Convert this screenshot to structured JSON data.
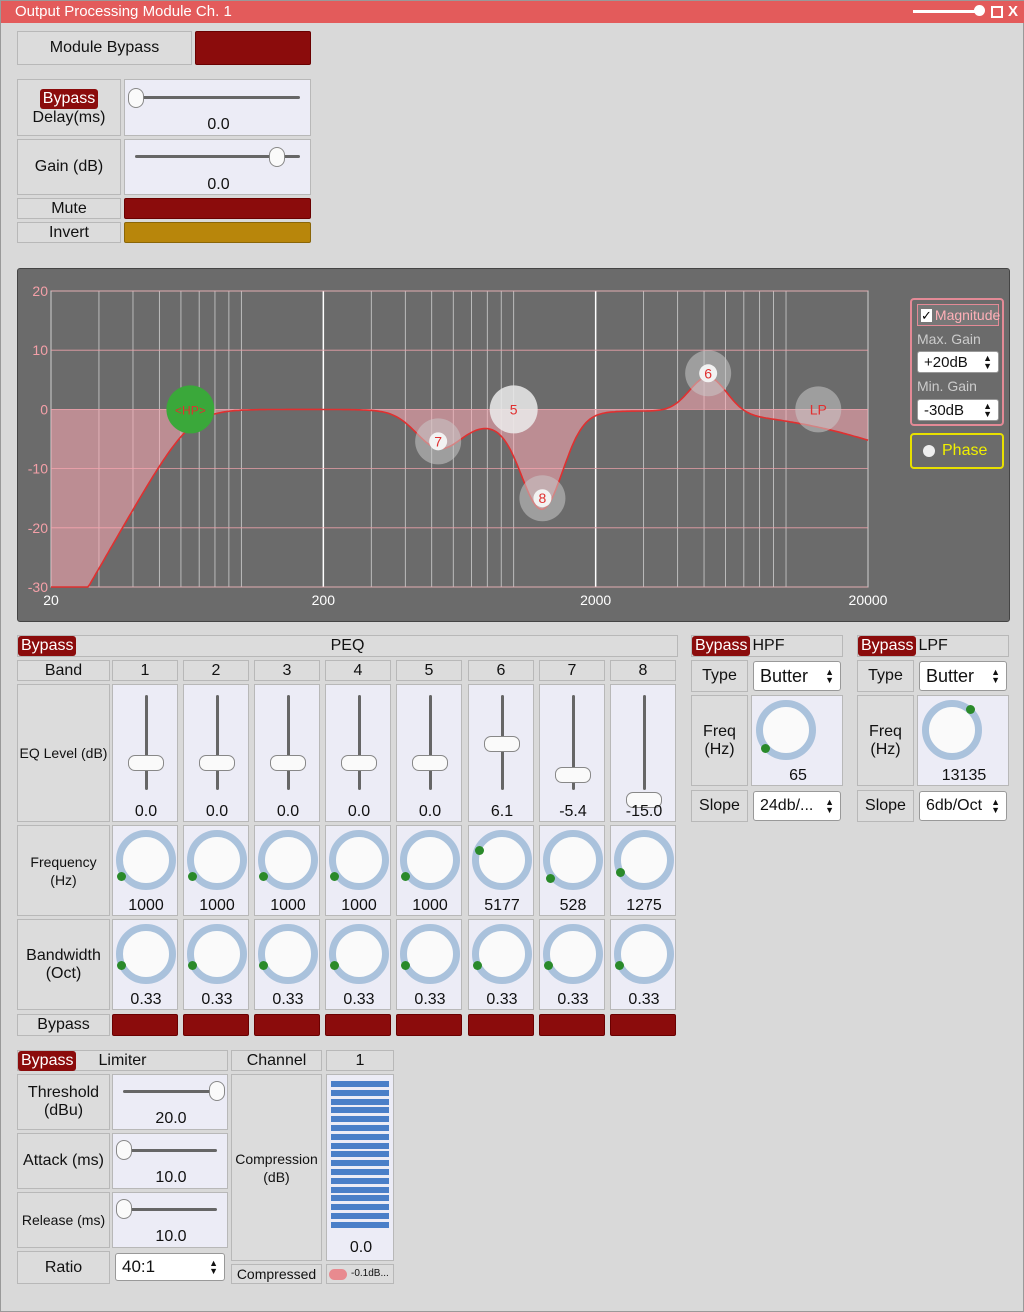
{
  "window": {
    "title": "Output Processing Module Ch. 1",
    "close_label": "X"
  },
  "top": {
    "module_bypass": "Module Bypass",
    "bypass_chip": "Bypass",
    "delay_label": "Delay(ms)",
    "delay_value": "0.0",
    "gain_label": "Gain (dB)",
    "gain_value": "0.0",
    "mute": "Mute",
    "invert": "Invert"
  },
  "graph": {
    "y_ticks": [
      "20",
      "10",
      "0",
      "-10",
      "-20",
      "-30"
    ],
    "x_ticks": [
      "20",
      "200",
      "2000",
      "20000"
    ],
    "nodes": [
      "<HP>",
      "7",
      "5",
      "8",
      "6",
      "LP"
    ],
    "magnitude_label": "Magnitude",
    "max_gain_label": "Max. Gain",
    "max_gain_value": "+20dB",
    "min_gain_label": "Min. Gain",
    "min_gain_value": "-30dB",
    "phase_label": "Phase"
  },
  "peq": {
    "bypass": "Bypass",
    "title": "PEQ",
    "band_label": "Band",
    "eq_level_label": "EQ Level (dB)",
    "frequency_label": "Frequency (Hz)",
    "bandwidth_label": "Bandwidth\n(Oct)",
    "bypass_row_label": "Bypass",
    "bands": [
      {
        "n": "1",
        "level": "0.0",
        "level_num": 0,
        "freq": "1000",
        "bw": "0.33"
      },
      {
        "n": "2",
        "level": "0.0",
        "level_num": 0,
        "freq": "1000",
        "bw": "0.33"
      },
      {
        "n": "3",
        "level": "0.0",
        "level_num": 0,
        "freq": "1000",
        "bw": "0.33"
      },
      {
        "n": "4",
        "level": "0.0",
        "level_num": 0,
        "freq": "1000",
        "bw": "0.33"
      },
      {
        "n": "5",
        "level": "0.0",
        "level_num": 0,
        "freq": "1000",
        "bw": "0.33"
      },
      {
        "n": "6",
        "level": "6.1",
        "level_num": 6.1,
        "freq": "5177",
        "bw": "0.33"
      },
      {
        "n": "7",
        "level": "-5.4",
        "level_num": -5.4,
        "freq": "528",
        "bw": "0.33"
      },
      {
        "n": "8",
        "level": "-15.0",
        "level_num": -15,
        "freq": "1275",
        "bw": "0.33"
      }
    ]
  },
  "hpf": {
    "bypass": "Bypass",
    "title": "HPF",
    "type_label": "Type",
    "type_value": "Butter",
    "freq_label": "Freq\n(Hz)",
    "freq_value": "65",
    "slope_label": "Slope",
    "slope_value": "24db/..."
  },
  "lpf": {
    "bypass": "Bypass",
    "title": "LPF",
    "type_label": "Type",
    "type_value": "Butter",
    "freq_label": "Freq\n(Hz)",
    "freq_value": "13135",
    "slope_label": "Slope",
    "slope_value": "6db/Oct"
  },
  "limiter": {
    "bypass": "Bypass",
    "title": "Limiter",
    "threshold_label": "Threshold\n(dBu)",
    "threshold_value": "20.0",
    "attack_label": "Attack (ms)",
    "attack_value": "10.0",
    "release_label": "Release (ms)",
    "release_value": "10.0",
    "ratio_label": "Ratio",
    "ratio_value": "40:1",
    "channel_label": "Channel",
    "channel_value": "1",
    "compression_label": "Compression\n(dB)",
    "compression_value": "0.0",
    "compressed_label": "Compressed",
    "compressed_value": "-0.1dB..."
  },
  "colors": {
    "accent_red": "#8b0c0c",
    "invert_gold": "#b8860b",
    "title_red": "#e35b5b",
    "curve": "#e03030",
    "knob_ring": "#aac2dc",
    "meter_blue": "#4a7fc8",
    "phase_yellow": "#e8e000"
  }
}
